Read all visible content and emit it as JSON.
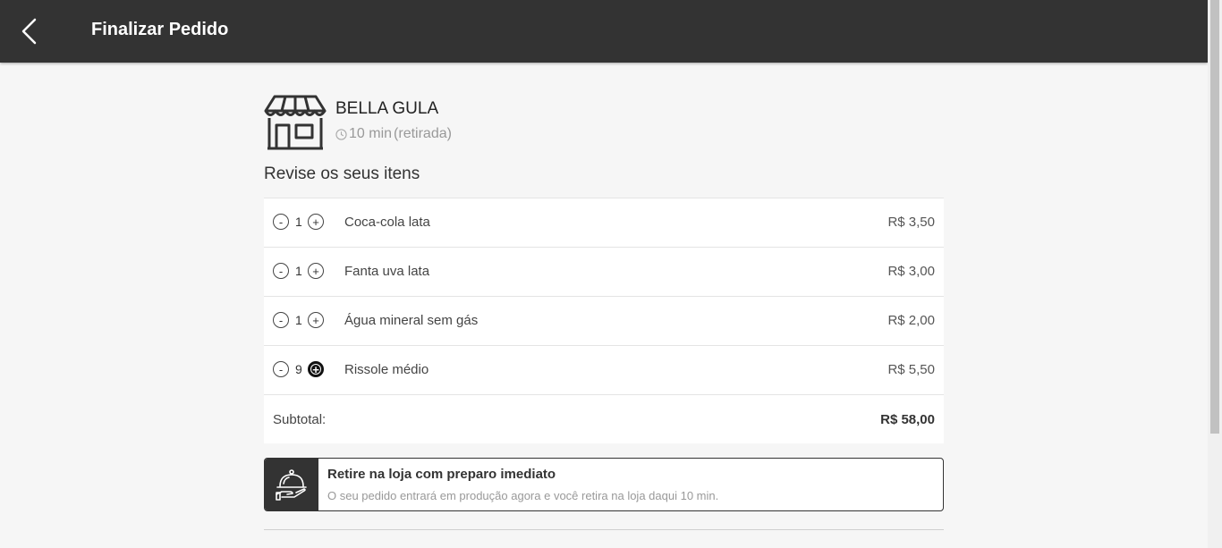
{
  "header": {
    "title": "Finalizar Pedido",
    "back_icon": "chevron-left-icon"
  },
  "store": {
    "name": "BELLA GULA",
    "time": "10 min",
    "mode": "(retirada)"
  },
  "review": {
    "title": "Revise os seus itens"
  },
  "items": [
    {
      "qty": "1",
      "name": "Coca-cola lata",
      "price": "R$ 3,50"
    },
    {
      "qty": "1",
      "name": "Fanta uva lata",
      "price": "R$ 3,00"
    },
    {
      "qty": "1",
      "name": "Água mineral sem gás",
      "price": "R$ 2,00"
    },
    {
      "qty": "9",
      "name": "Rissole médio",
      "price": "R$ 5,50"
    }
  ],
  "controls": {
    "minus": "-",
    "plus": "+"
  },
  "subtotal": {
    "label": "Subtotal:",
    "value": "R$ 58,00"
  },
  "pickup": {
    "title": "Retire na loja com preparo imediato",
    "description": "O seu pedido entrará em produção agora e você retira na loja daqui 10 min.",
    "icon": "serving-cloche-icon"
  },
  "colors": {
    "topbar": "#333333",
    "background": "#f6f6f6",
    "accent": "#111111"
  }
}
